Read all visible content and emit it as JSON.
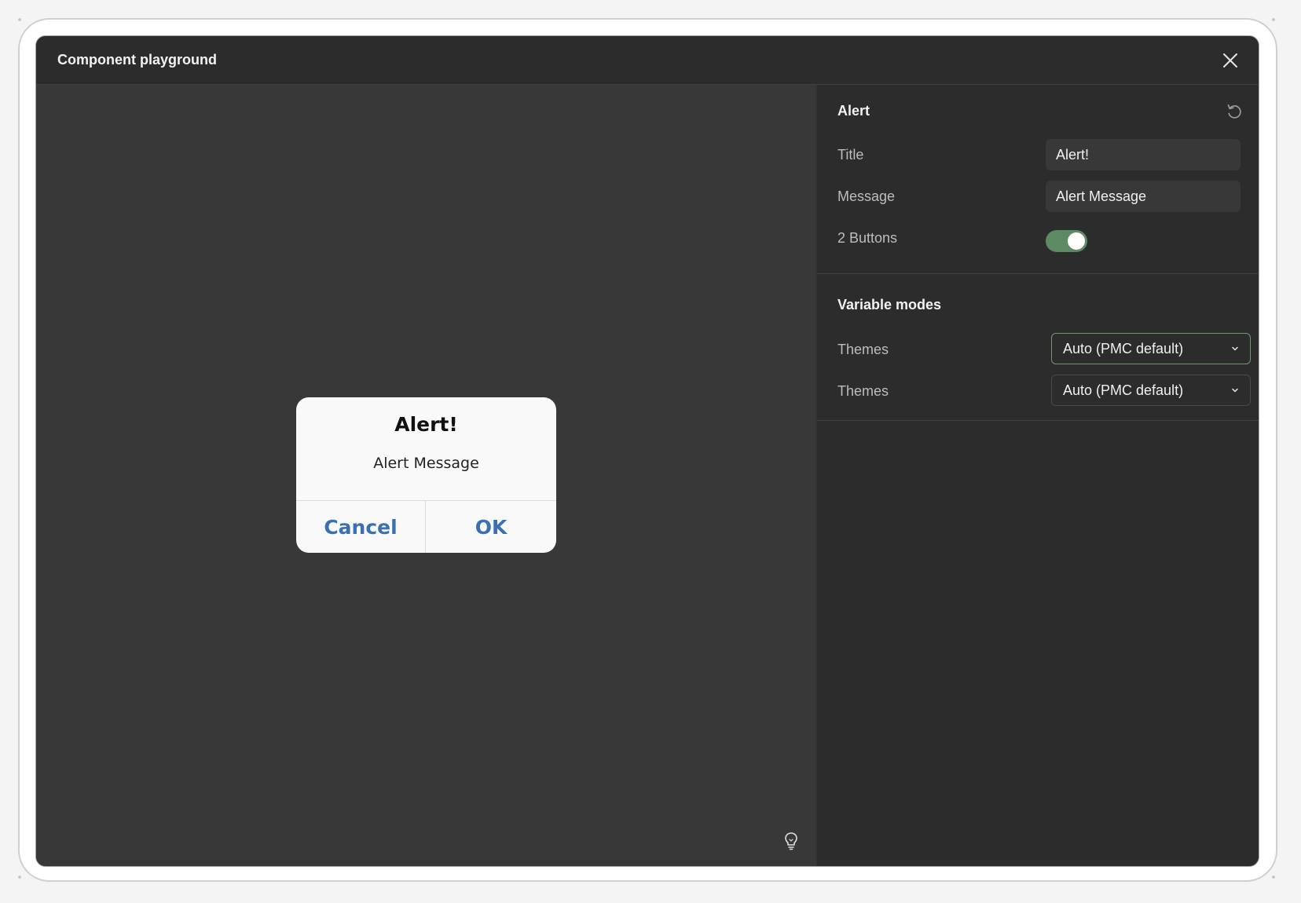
{
  "window": {
    "title": "Component playground"
  },
  "preview": {
    "alert_title": "Alert!",
    "alert_message": "Alert Message",
    "cancel_label": "Cancel",
    "ok_label": "OK",
    "accent_color": "#3a6fb4"
  },
  "panel": {
    "alert_section": {
      "heading": "Alert",
      "title_label": "Title",
      "title_value": "Alert!",
      "message_label": "Message",
      "message_value": "Alert Message",
      "buttons_label": "2 Buttons",
      "buttons_toggle_on": true,
      "toggle_color": "#5c8a62"
    },
    "modes_section": {
      "heading": "Variable modes",
      "themes": [
        {
          "label": "Themes",
          "value": "Auto (PMC default)"
        },
        {
          "label": "Themes",
          "value": "Auto (PMC default)"
        }
      ]
    }
  },
  "icons": [
    "close-icon",
    "reset-icon",
    "chevron-down-icon",
    "lightbulb-icon"
  ]
}
